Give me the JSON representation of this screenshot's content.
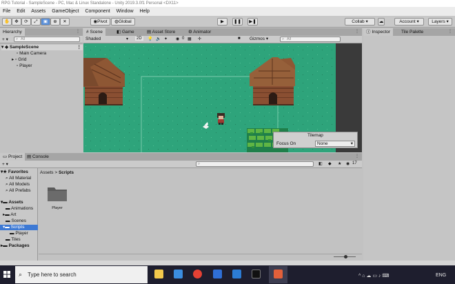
{
  "window": {
    "title": "RPG Tutorial - SampleScene - PC, Mac & Linux Standalone - Unity 2019.3.0f1 Personal <DX11>"
  },
  "menu": {
    "items": [
      "File",
      "Edit",
      "Assets",
      "GameObject",
      "Component",
      "Window",
      "Help"
    ]
  },
  "toolbar": {
    "pivot_label": "Pivot",
    "global_label": "Global",
    "collab_label": "Collab ▾",
    "account_label": "Account ▾",
    "layers_label": "Layers ▾"
  },
  "hierarchy": {
    "tab_label": "Hierarchy",
    "search_placeholder": "All",
    "create_label": "+ ▾",
    "scene_name": "SampleScene",
    "items": [
      "Main Camera",
      "Grid",
      "Player"
    ]
  },
  "scene": {
    "tabs": [
      "Scene",
      "Game",
      "Asset Store",
      "Animator"
    ],
    "shading_mode": "Shaded",
    "mode_2d": "2D",
    "gizmos_label": "Gizmos ▾",
    "search_placeholder": "All",
    "overlay_count": "0"
  },
  "tilemap_overlay": {
    "title": "Tilemap",
    "focus_label": "Focus On",
    "focus_value": "None"
  },
  "inspector": {
    "tabs": [
      "Inspector",
      "Tile Palette"
    ]
  },
  "project": {
    "tabs": [
      "Project",
      "Console"
    ],
    "create_label": "+ ▾",
    "breadcrumb": [
      "Assets",
      "Scripts"
    ],
    "breadcrumb_separator": ">",
    "hidden_count": "17",
    "favorites_title": "Favorites",
    "favorites": [
      "All Material",
      "All Models",
      "All Prefabs"
    ],
    "assets_title": "Assets",
    "asset_folders": [
      "Animations",
      "Art",
      "Scenes",
      "Scripts",
      "Player",
      "Tiles"
    ],
    "packages_title": "Packages",
    "grid_items": [
      {
        "name": "Player",
        "icon": "folder-icon"
      }
    ]
  },
  "taskbar": {
    "search_placeholder": "Type here to search",
    "language": "ENG",
    "apps": [
      "file-explorer-icon",
      "mail-icon",
      "chrome-icon",
      "vpn-icon",
      "vscode-icon",
      "terminal-icon",
      "app-icon"
    ]
  },
  "colors": {
    "scene_bg": "#2ea47b",
    "selection": "#3d79d4",
    "taskbar": "#1e1e2e"
  }
}
